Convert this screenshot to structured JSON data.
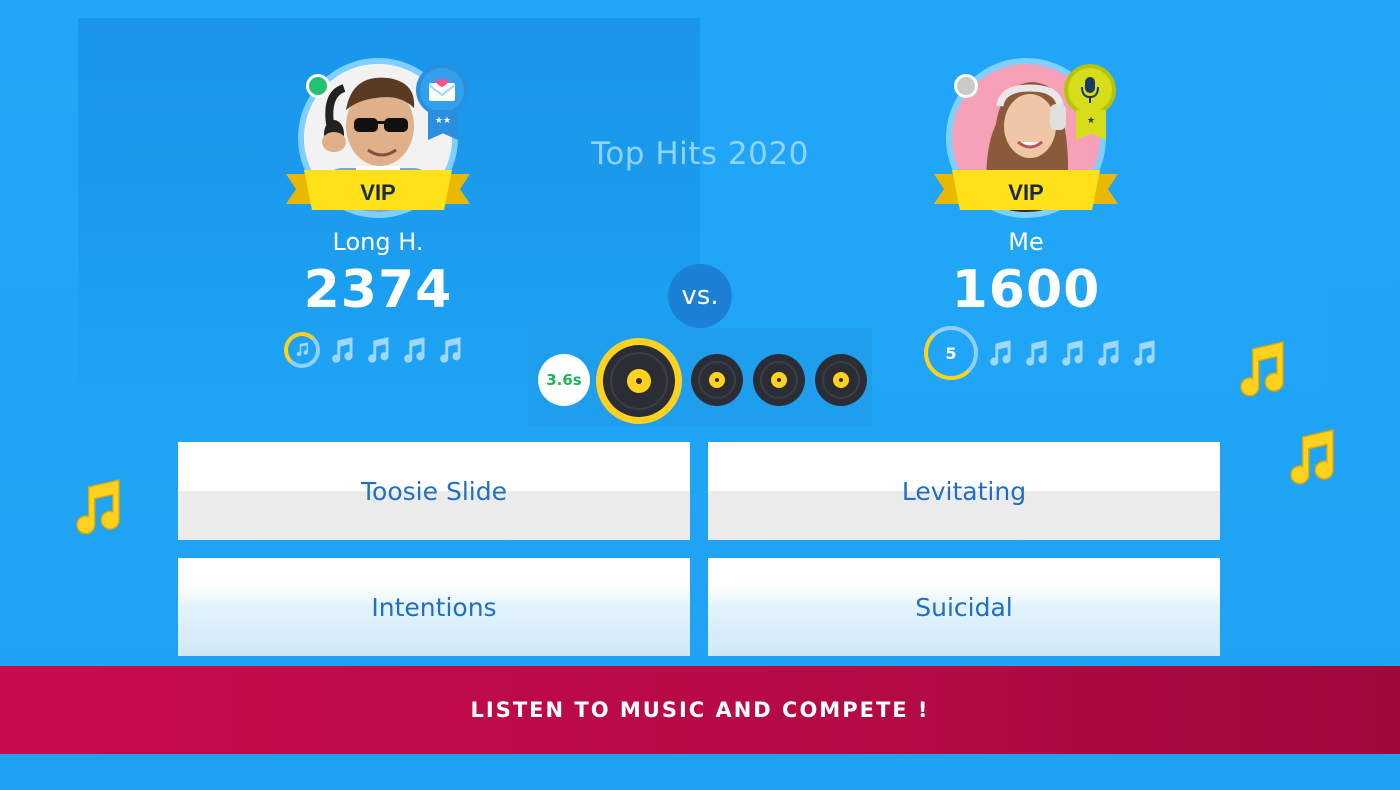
{
  "quiz": {
    "title": "Top Hits 2020",
    "vs_label": "vs."
  },
  "players": {
    "left": {
      "vip": "VIP",
      "name": "Long H.",
      "score": "2374",
      "status_color": "#21c373",
      "badge_stars": "★★",
      "badge_icon": "envelope-heart-icon"
    },
    "right": {
      "vip": "VIP",
      "name": "Me",
      "score": "1600",
      "status_color": "#c9c9c9",
      "timer_value": "5",
      "badge_icon": "microphone-icon"
    }
  },
  "round": {
    "time": "3.6s"
  },
  "answers": [
    "Toosie Slide",
    "Levitating",
    "Intentions",
    "Suicidal"
  ],
  "banner": {
    "text": "LISTEN TO MUSIC AND COMPETE !"
  },
  "colors": {
    "background": "#1ea3f5",
    "gold": "#ffd21f",
    "banner": "#c90b4d",
    "answer_text": "#1f6fc2"
  }
}
